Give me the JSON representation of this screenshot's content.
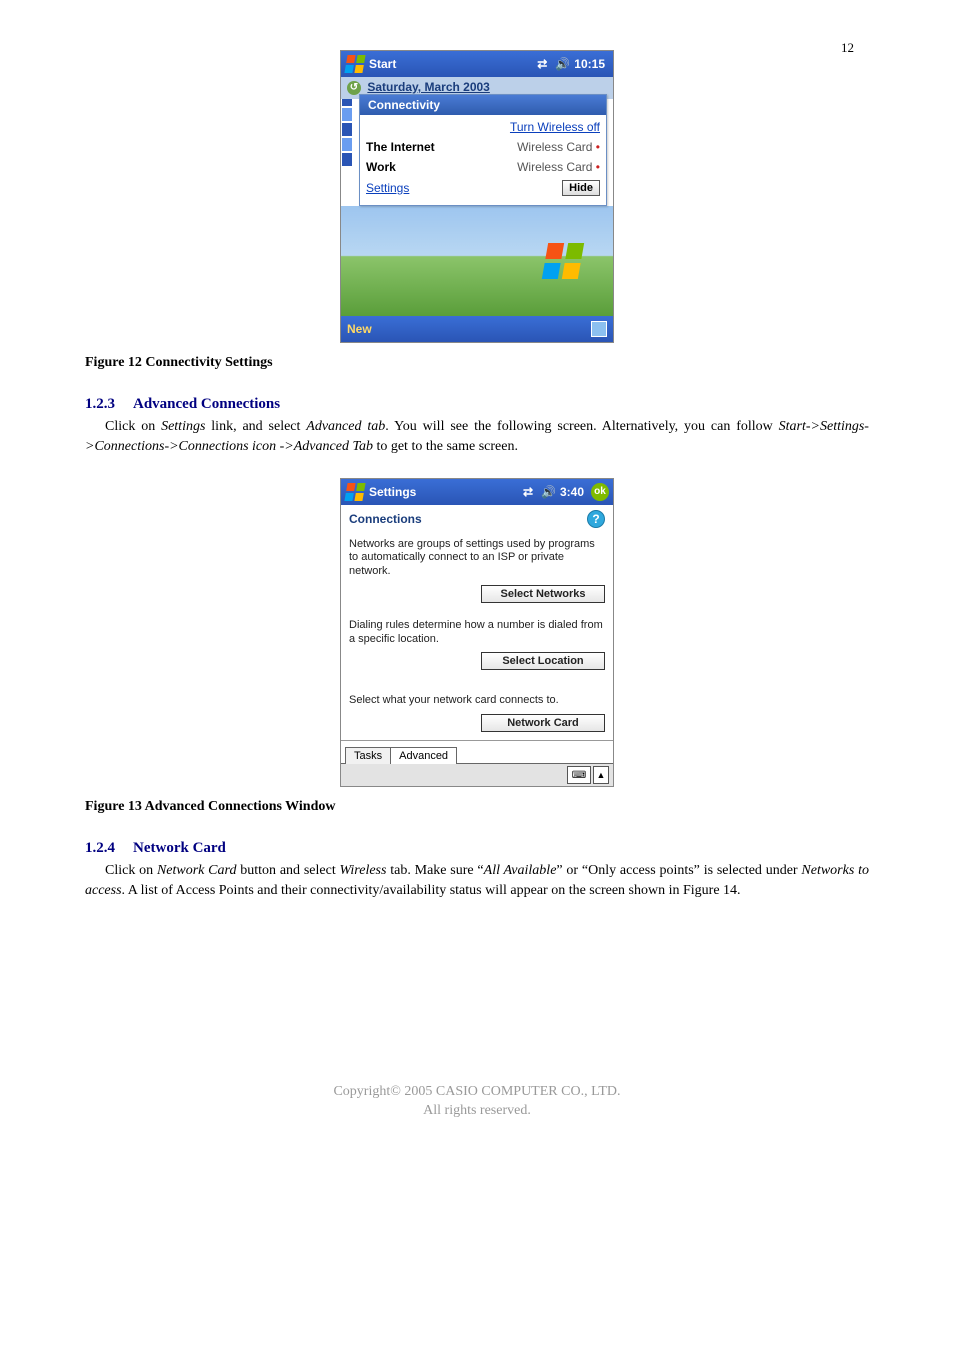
{
  "page_number": "12",
  "figure1": {
    "caption": "Figure 12 Connectivity Settings",
    "taskbar": {
      "title": "Start",
      "time": "10:15"
    },
    "date": "Saturday, March    2003",
    "popup_title": "Connectivity",
    "turn_off": "Turn Wireless off",
    "rows": {
      "internet_label": "The Internet",
      "internet_val": "Wireless Card",
      "work_label": "Work",
      "work_val": "Wireless Card"
    },
    "settings_link": "Settings",
    "hide_btn": "Hide",
    "menu_left": "New"
  },
  "section1": {
    "num": "1.2.3",
    "title": "Advanced Connections",
    "para_a": "Click on ",
    "para_b": "Settings",
    "para_c": " link, and select ",
    "para_d": "Advanced tab",
    "para_e": ". You will see the following screen. Alternatively, you can follow ",
    "para_f": "Start->Settings->Connections->Connections icon ->Advanced Tab",
    "para_g": " to get to the same screen."
  },
  "figure2": {
    "caption": "Figure 13 Advanced Connections Window",
    "taskbar": {
      "title": "Settings",
      "time": "3:40",
      "ok": "ok"
    },
    "subtitle": "Connections",
    "groups": {
      "net_desc": "Networks are groups of settings used by programs to automatically connect to an ISP or private network.",
      "net_btn": "Select Networks",
      "dial_desc": "Dialing rules determine how a number is dialed from a specific location.",
      "dial_btn": "Select Location",
      "card_desc": "Select what your network card connects to.",
      "card_btn": "Network Card"
    },
    "tabs": {
      "a": "Tasks",
      "b": "Advanced"
    }
  },
  "section2": {
    "num": "1.2.4",
    "title": "Network Card",
    "para_a": "Click on ",
    "para_b": "Network Card",
    "para_c": " button and select ",
    "para_d": "Wireless",
    "para_e": " tab. Make sure “",
    "para_f": "All Available",
    "para_g": "” or “Only access points” is selected under ",
    "para_h": "Networks to access",
    "para_i": ". A list of Access Points and their connectivity/availability status will appear on the screen shown in Figure 14."
  },
  "footer": {
    "line1": "Copyright© 2005 CASIO COMPUTER CO., LTD.",
    "line2": "All rights reserved."
  }
}
